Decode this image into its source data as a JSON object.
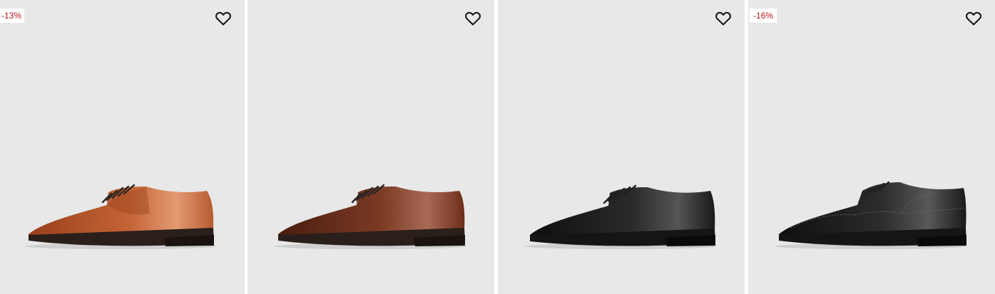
{
  "products": [
    {
      "discount_badge": "-13%",
      "wishlist_icon": "heart-outline-icon",
      "image": "plain-derby-shoe",
      "colors": {
        "upper": "#b9542a",
        "upper_light": "#e08a5e",
        "upper_dark": "#7a2f14",
        "sole": "#2a1f1a",
        "lace": "#2b2420"
      }
    },
    {
      "discount_badge": "",
      "wishlist_icon": "heart-outline-icon",
      "image": "plain-derby-shoe",
      "colors": {
        "upper": "#6b2c1a",
        "upper_light": "#9a5a44",
        "upper_dark": "#3e160b",
        "sole": "#2a1f1a",
        "lace": "#2b2420"
      }
    },
    {
      "discount_badge": "",
      "wishlist_icon": "heart-outline-icon",
      "image": "plain-derby-shoe",
      "colors": {
        "upper": "#1c1c1c",
        "upper_light": "#4a4a4a",
        "upper_dark": "#0a0a0a",
        "sole": "#151515",
        "lace": "#202020"
      }
    },
    {
      "discount_badge": "-16%",
      "wishlist_icon": "heart-outline-icon",
      "image": "brogue-oxford-shoe",
      "colors": {
        "upper": "#1e1e1e",
        "upper_light": "#4c4c4c",
        "upper_dark": "#0b0b0b",
        "sole": "#151515",
        "lace": "#202020"
      }
    }
  ],
  "colors": {
    "card_background": "#e8e8e8",
    "badge_text": "#c0141c",
    "badge_background": "#ffffff"
  }
}
